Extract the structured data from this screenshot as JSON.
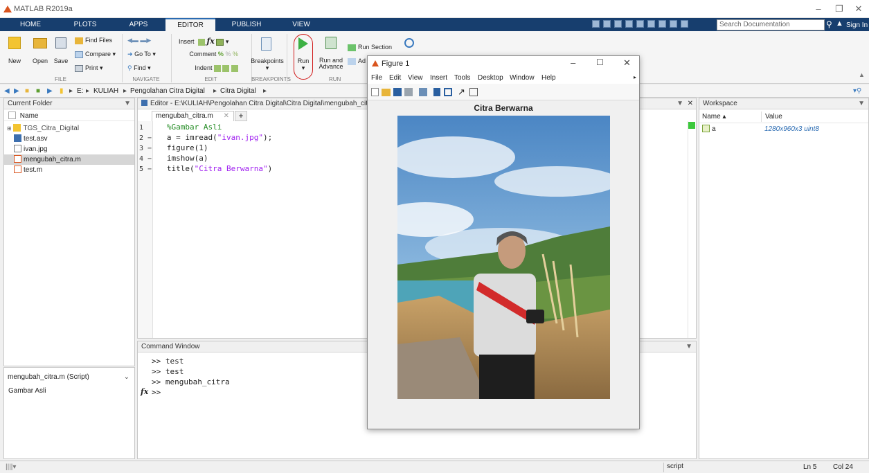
{
  "app": {
    "title": "MATLAB R2019a"
  },
  "tabs": [
    "HOME",
    "PLOTS",
    "APPS",
    "EDITOR",
    "PUBLISH",
    "VIEW"
  ],
  "search": {
    "placeholder": "Search Documentation"
  },
  "sign_in": "Sign In",
  "ribbon": {
    "file": {
      "new": "New",
      "open": "Open",
      "save": "Save",
      "find_files": "Find Files",
      "compare": "Compare",
      "print": "Print",
      "label": "FILE"
    },
    "navigate": {
      "go_to": "Go To",
      "find": "Find",
      "label": "NAVIGATE"
    },
    "edit": {
      "insert": "Insert",
      "comment": "Comment",
      "indent": "Indent",
      "label": "EDIT"
    },
    "breakpoints": {
      "button": "Breakpoints",
      "label": "BREAKPOINTS"
    },
    "run": {
      "run": "Run",
      "run_advance_1": "Run and",
      "run_advance_2": "Advance",
      "run_section": "Run Section",
      "advance": "Ad",
      "label": "RUN"
    }
  },
  "address": {
    "drive": "E:",
    "segments": [
      "KULIAH",
      "Pengolahan Citra Digital",
      "Citra Digital"
    ]
  },
  "current_folder": {
    "title": "Current Folder",
    "column": "Name",
    "items": [
      "TGS_Citra_Digital",
      "test.asv",
      "ivan.jpg",
      "mengubah_citra.m",
      "test.m"
    ],
    "details_selected": "mengubah_citra.m  (Script)",
    "details_text": "Gambar Asli"
  },
  "editor": {
    "title": "Editor - E:\\KULIAH\\Pengolahan Citra Digital\\Citra Digital\\mengubah_citr",
    "tab": "mengubah_citra.m",
    "lines": [
      {
        "n": "1",
        "parts": [
          {
            "t": "   %Gambar Asli",
            "c": "cmt"
          }
        ]
      },
      {
        "n": "2 −",
        "parts": [
          {
            "t": "   a = imread(",
            "c": ""
          },
          {
            "t": "\"ivan.jpg\"",
            "c": "str"
          },
          {
            "t": ");",
            "c": ""
          }
        ]
      },
      {
        "n": "3 −",
        "parts": [
          {
            "t": "   figure(1)",
            "c": ""
          }
        ]
      },
      {
        "n": "4 −",
        "parts": [
          {
            "t": "   imshow(a)",
            "c": ""
          }
        ]
      },
      {
        "n": "5 −",
        "parts": [
          {
            "t": "   title(",
            "c": ""
          },
          {
            "t": "\"Citra Berwarna\"",
            "c": "str"
          },
          {
            "t": ")",
            "c": ""
          }
        ]
      }
    ]
  },
  "command_window": {
    "title": "Command Window",
    "lines": [
      ">> test",
      ">> test",
      ">> mengubah_citra"
    ],
    "prompt": ">>",
    "fx": "fx"
  },
  "workspace": {
    "title": "Workspace",
    "col_name": "Name ▴",
    "col_value": "Value",
    "var_name": "a",
    "var_value": "1280x960x3 uint8"
  },
  "figure": {
    "title": "Figure 1",
    "menus": [
      "File",
      "Edit",
      "View",
      "Insert",
      "Tools",
      "Desktop",
      "Window",
      "Help"
    ],
    "plot_title": "Citra Berwarna"
  },
  "status": {
    "mode": "script",
    "ln": "Ln  5",
    "col": "Col  24"
  },
  "colors": {
    "tabbar": "#173e6e",
    "accent": "#2a6bb2",
    "comment": "#228b22",
    "string": "#a020f0"
  }
}
